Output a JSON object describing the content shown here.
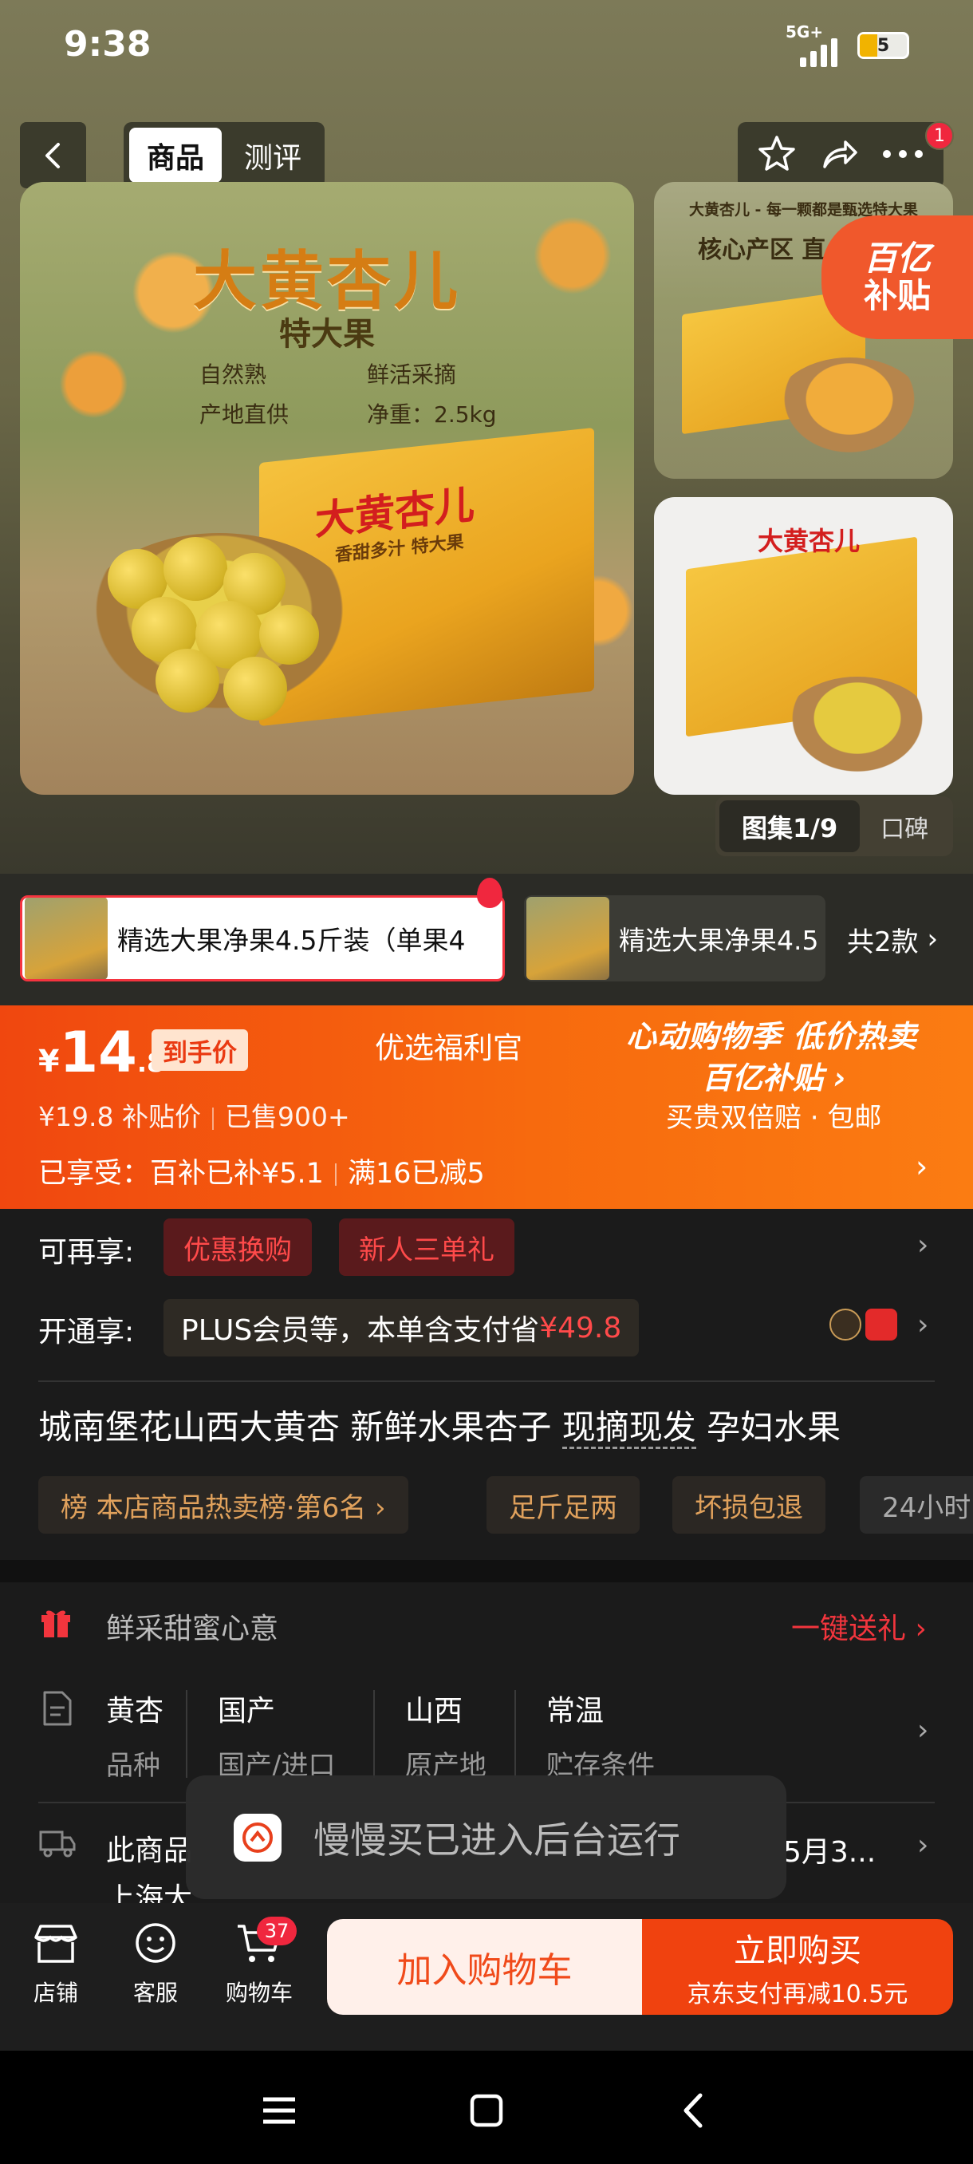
{
  "status_bar": {
    "time": "9:38",
    "network": "5G+",
    "battery": "5"
  },
  "nav": {
    "tabs": [
      {
        "label": "商品",
        "active": true
      },
      {
        "label": "测评",
        "active": false
      }
    ],
    "notification_count": "1"
  },
  "hero": {
    "main_image": {
      "title": "大黄杏儿",
      "subtitle": "特大果",
      "features": [
        "自然熟",
        "鲜活采摘",
        "产地直供",
        "净重：2.5kg"
      ],
      "box_text": "大黄杏儿",
      "box_subtext": "香甜多汁 特大果"
    },
    "thumb1": {
      "line1": "大黄杏儿 - 每一颗都是甄选特大果",
      "line2": "核心产区 直"
    },
    "subsidy_badge": {
      "line1": "百亿",
      "line2": "补贴"
    },
    "thumb2": {
      "box_text": "大黄杏儿"
    },
    "gallery": {
      "active": "图集1/9",
      "other": "口碑"
    }
  },
  "sku": {
    "items": [
      {
        "label": "精选大果净果4.5斤装（单果4",
        "selected": true
      },
      {
        "label": "精选大果净果4.5",
        "selected": false
      }
    ],
    "more": "共2款"
  },
  "price": {
    "currency": "¥",
    "integer": "14",
    "decimal": ".8",
    "tag": "到手价",
    "store": "优选福利官",
    "original": "¥19.8  补贴价",
    "sold": "已售900+",
    "promo_title": "心动购物季 低价热卖",
    "promo_sub": "百亿补贴 ›",
    "promo_sub2": "买贵双倍赔 · 包邮",
    "enjoyed_prefix": "已享受：",
    "enjoyed_a": "百补已补¥5.1",
    "enjoyed_b": "满16已减5"
  },
  "offers": {
    "label": "可再享:",
    "pills": [
      "优惠换购",
      "新人三单礼"
    ]
  },
  "plus": {
    "label": "开通享:",
    "text": "PLUS会员等，本单含支付省",
    "amount": "¥49.8"
  },
  "product": {
    "title_a": "城南堡花山西大黄杏 新鲜水果杏子 ",
    "title_ul": "现摘现发",
    "title_b": " 孕妇水果",
    "tags": [
      "榜 本店商品热卖榜·第6名 ›",
      "足斤足两",
      "坏损包退",
      "24小时"
    ]
  },
  "gift": {
    "label": "鲜采甜蜜心意",
    "link": "一键送礼 ›"
  },
  "attributes": [
    {
      "value": "黄杏",
      "key": "品种"
    },
    {
      "value": "国产",
      "key": "国产/进口"
    },
    {
      "value": "山西",
      "key": "原产地"
    },
    {
      "value": "常温",
      "key": "贮存条件"
    }
  ],
  "shipping": {
    "label": "此商品",
    "date": "5月3...",
    "line2": "上海大"
  },
  "toast": {
    "text": "慢慢买已进入后台运行"
  },
  "bottom_bar": {
    "items": [
      {
        "label": "店铺",
        "icon": "shop-icon"
      },
      {
        "label": "客服",
        "icon": "chat-icon"
      },
      {
        "label": "购物车",
        "icon": "cart-icon"
      }
    ],
    "cart_count": "37",
    "add_to_cart": "加入购物车",
    "buy_now": "立即购买",
    "buy_now_sub": "京东支付再减10.5元"
  },
  "colors": {
    "accent": "#f0420f",
    "badge": "#f0273e"
  }
}
